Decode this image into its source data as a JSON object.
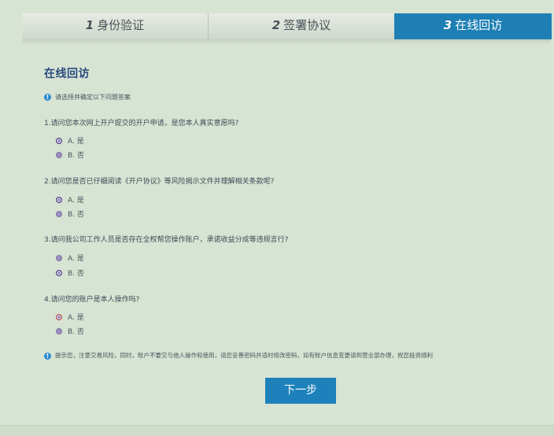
{
  "steps": [
    {
      "num": "1",
      "label": "身份验证"
    },
    {
      "num": "2",
      "label": "签署协议"
    },
    {
      "num": "3",
      "label": "在线回访"
    }
  ],
  "title": "在线回访",
  "intro": "请选择并确定以下问题答案",
  "questions": [
    {
      "text": "1.请问您本次网上开户提交的开户申请，是您本人真实意愿吗?",
      "options": [
        "A. 是",
        "B. 否"
      ],
      "selected": "A. 是"
    },
    {
      "text": "2.请问您是否已仔细阅读《开户协议》等风险揭示文件并理解相关条款呢?",
      "options": [
        "A. 是",
        "B. 否"
      ],
      "selected": "A. 是"
    },
    {
      "text": "3.请问我公司工作人员是否存在全权帮您操作账户，承诺收益分成等违规言行?",
      "options": [
        "A. 是",
        "B. 否"
      ],
      "selected": "B. 否"
    },
    {
      "text": "4.请问您的账户是本人操作吗?",
      "options": [
        "A. 是",
        "B. 否"
      ],
      "selected": "A. 是"
    }
  ],
  "notice": "提示您，注意交易风险，同时，账户不要交与他人操作和使用，请您妥善密码并适时修改密码，如有账户信息变更请到营业部办理，祝您投资顺利",
  "next_button": "下一步",
  "colors": {
    "accent": "#1d7fb4",
    "background": "#d7e3d3",
    "title": "#2a4c7e"
  }
}
